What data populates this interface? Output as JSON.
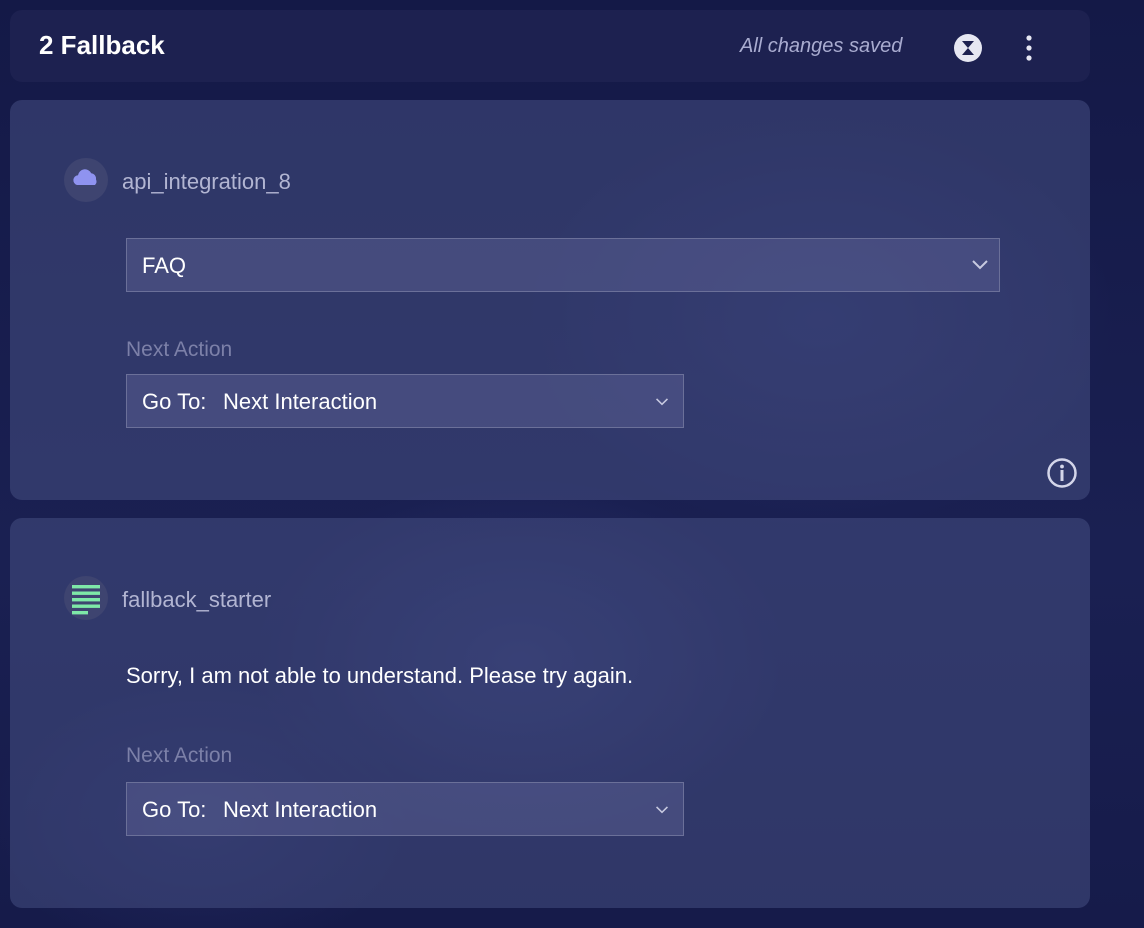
{
  "header": {
    "title": "2 Fallback",
    "save_status": "All changes saved",
    "close_icon": "close-circle-icon",
    "more_icon": "more-vertical-icon"
  },
  "cards": [
    {
      "node_icon": "cloud-icon",
      "node_name": "api_integration_8",
      "select_value": "FAQ",
      "next_action_label": "Next Action",
      "next_action_prefix": "Go To:",
      "next_action_value": "Next Interaction",
      "info_icon": "info-icon"
    },
    {
      "node_icon": "text-lines-icon",
      "node_name": "fallback_starter",
      "message": "Sorry, I am not able to understand. Please try again.",
      "next_action_label": "Next Action",
      "next_action_prefix": "Go To:",
      "next_action_value": "Next Interaction"
    }
  ],
  "colors": {
    "cloud_icon": "#8f93f0",
    "text_icon": "#7ee8a8",
    "label": "#7c80a8"
  }
}
